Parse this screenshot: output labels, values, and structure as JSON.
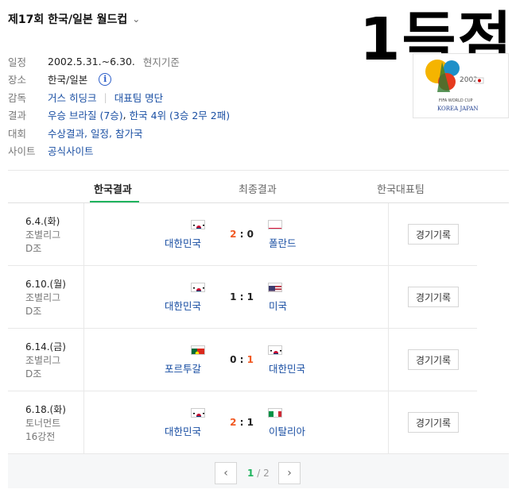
{
  "header": {
    "title": "제17회 한국/일본 월드컵",
    "chevron_icon": "chevron-down-icon"
  },
  "overlay_text": "1득점",
  "info": {
    "period": {
      "label": "일정",
      "value": "2002.5.31.~6.30.",
      "note": "현지기준"
    },
    "venue": {
      "label": "장소",
      "value": "한국/일본",
      "icon": "info-icon"
    },
    "coach": {
      "label": "감독",
      "value": "거스 히딩크",
      "extra": "대표팀 명단"
    },
    "result": {
      "label": "결과",
      "winner": "우승 브라질 (7승)",
      "sep": ",",
      "korea": "한국 4위 (3승 2무 2패)"
    },
    "tournament": {
      "label": "대회",
      "links": [
        "수상결과",
        "일정",
        "참가국"
      ]
    },
    "site": {
      "label": "사이트",
      "value": "공식사이트"
    }
  },
  "tabs": [
    {
      "label": "한국결과",
      "active": true
    },
    {
      "label": "최종결과",
      "active": false
    },
    {
      "label": "한국대표팀",
      "active": false
    }
  ],
  "matches": [
    {
      "date": "6.4.(화)",
      "stage1": "조별리그",
      "stage2": "D조",
      "home": "대한민국",
      "home_score": "2",
      "away_score": "0",
      "away": "폴란드",
      "button": "경기기록",
      "winner": "home"
    },
    {
      "date": "6.10.(월)",
      "stage1": "조별리그",
      "stage2": "D조",
      "home": "대한민국",
      "home_score": "1",
      "away_score": "1",
      "away": "미국",
      "button": "경기기록",
      "winner": "none"
    },
    {
      "date": "6.14.(금)",
      "stage1": "조별리그",
      "stage2": "D조",
      "home": "포르투갈",
      "home_score": "0",
      "away_score": "1",
      "away": "대한민국",
      "button": "경기기록",
      "winner": "away"
    },
    {
      "date": "6.18.(화)",
      "stage1": "토너먼트",
      "stage2": "16강전",
      "home": "대한민국",
      "home_score": "2",
      "away_score": "1",
      "away": "이탈리아",
      "button": "경기기록",
      "winner": "home"
    }
  ],
  "pager": {
    "current": "1",
    "sep": "/",
    "total": "2",
    "prev_icon": "chevron-left-icon",
    "next_icon": "chevron-right-icon"
  },
  "colors": {
    "accent": "#1fb45e",
    "link": "#1a4fa3",
    "win": "#f15a24"
  }
}
